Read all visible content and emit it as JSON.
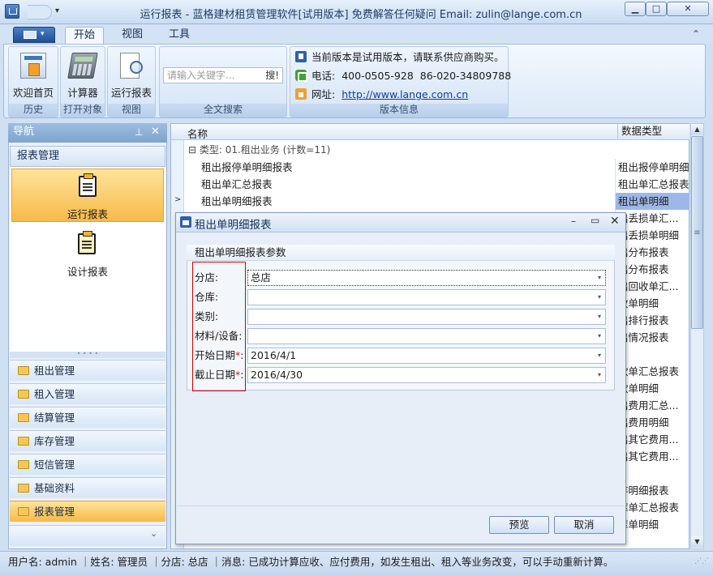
{
  "window": {
    "title": "运行报表 - 蓝格建材租赁管理软件[试用版本] 免费解答任何疑问 Email: zulin@lange.com.cn",
    "min": "▁",
    "max": "□",
    "close": "✕",
    "qat_dropdown": "▾"
  },
  "ribbon": {
    "app_menu_arrow": "▾",
    "tabs": [
      "开始",
      "视图",
      "工具"
    ],
    "collapse": "⌃",
    "groups": {
      "history": {
        "label": "历史",
        "button": "欢迎首页"
      },
      "open": {
        "label": "打开对象",
        "button": "计算器"
      },
      "view": {
        "label": "视图",
        "button": "运行报表"
      },
      "search": {
        "label": "全文搜索",
        "placeholder": "请输入关键字...",
        "button": "搜!"
      },
      "version": {
        "label": "版本信息",
        "notice": "当前版本是试用版本，请联系供应商购买。",
        "phone_label": "电话:",
        "phone1": "400-0505-928",
        "phone2": "86-020-34809788",
        "site_label": "网址:",
        "site_url": "http://www.lange.com.cn"
      }
    }
  },
  "nav": {
    "title": "导航",
    "pin": "⊥",
    "close": "✕",
    "section": "报表管理",
    "tiles": [
      "运行报表",
      "设计报表"
    ],
    "splitter": "• • • •",
    "groups": [
      "租出管理",
      "租入管理",
      "结算管理",
      "库存管理",
      "短信管理",
      "基础资料",
      "报表管理"
    ],
    "footer_chevron": "⌄"
  },
  "grid": {
    "columns": {
      "name": "名称",
      "type": "数据类型"
    },
    "group_row": "⊟ 类型: 01.租出业务 (计数=11)",
    "row_arrow": ">",
    "rows": [
      {
        "name": "租出报停单明细报表",
        "type": "租出报停单明细"
      },
      {
        "name": "租出单汇总报表",
        "type": "租出单汇总报表"
      },
      {
        "name": "租出单明细报表",
        "type": "租出单明细"
      }
    ],
    "visible_types": [
      "出丢损单汇...",
      "出丢损单明细",
      "出分布报表",
      "出分布报表",
      "出回收单汇...",
      "收单明细",
      "出排行报表",
      "出情况报表",
      "",
      "款单汇总报表",
      "款单明细",
      "出费用汇总...",
      "出费用明细",
      "出其它费用...",
      "出其它费用...",
      "",
      "存明细报表",
      "库单汇总报表",
      "库单明细"
    ],
    "scroll_up": "▲",
    "scroll_down": "▼",
    "scroll_grip": "≡"
  },
  "dialog": {
    "title": "租出单明细报表",
    "min": "–",
    "max": "▭",
    "close": "✕",
    "params_title": "租出单明细报表参数",
    "fields": [
      {
        "label": "分店:",
        "required": "",
        "value": "总店"
      },
      {
        "label": "仓库:",
        "required": "",
        "value": ""
      },
      {
        "label": "类别:",
        "required": "",
        "value": ""
      },
      {
        "label": "材料/设备:",
        "required": "",
        "value": ""
      },
      {
        "label": "开始日期",
        "required": "*",
        "value": "2016/4/1"
      },
      {
        "label": "截止日期",
        "required": "*",
        "value": "2016/4/30"
      }
    ],
    "dropdown_arrow": "▾",
    "colon": ":",
    "buttons": {
      "preview": "预览",
      "cancel": "取消"
    }
  },
  "status": {
    "text": "用户名: admin ｜姓名: 管理员 ｜分店: 总店 ｜消息: 已成功计算应收、应付费用，如发生租出、租入等业务改变，可以手动重新计算。",
    "grip": "⋰⋰"
  }
}
